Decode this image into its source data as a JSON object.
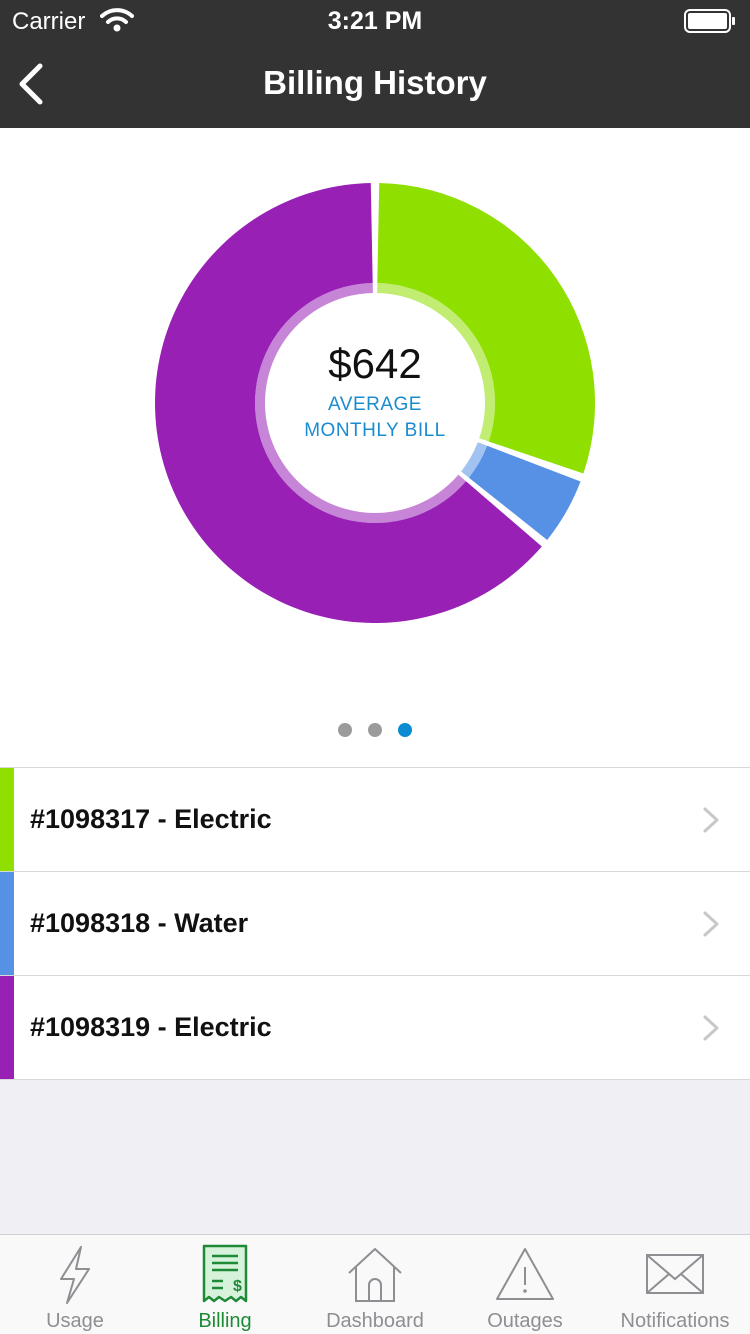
{
  "status_bar": {
    "carrier": "Carrier",
    "time": "3:21 PM"
  },
  "nav": {
    "title": "Billing History"
  },
  "summary": {
    "amount": "$642",
    "label": "AVERAGE MONTHLY BILL"
  },
  "chart_data": {
    "type": "pie",
    "slices": [
      {
        "name": "#1098317 - Electric",
        "fraction": 0.305,
        "color": "#8fdf00"
      },
      {
        "name": "#1098318 - Water",
        "fraction": 0.055,
        "color": "#5691e6"
      },
      {
        "name": "#1098319 - Electric",
        "fraction": 0.64,
        "color": "#9820b5"
      }
    ]
  },
  "pager": {
    "count": 3,
    "active_index": 2,
    "active_color": "#0a8bd2",
    "inactive_color": "#9b9b9b"
  },
  "accounts": [
    {
      "label": "#1098317 - Electric",
      "color": "#8fdf00"
    },
    {
      "label": "#1098318 - Water",
      "color": "#5691e6"
    },
    {
      "label": "#1098319 - Electric",
      "color": "#9820b5"
    }
  ],
  "tabs": [
    {
      "label": "Usage",
      "icon": "lightning-icon",
      "active": false
    },
    {
      "label": "Billing",
      "icon": "bill-icon",
      "active": true
    },
    {
      "label": "Dashboard",
      "icon": "house-icon",
      "active": false
    },
    {
      "label": "Outages",
      "icon": "warning-icon",
      "active": false
    },
    {
      "label": "Notifications",
      "icon": "envelope-icon",
      "active": false
    }
  ],
  "colors": {
    "bar": "#333333",
    "active_tab": "#1e8a36",
    "accent_text": "#1a8ccf"
  }
}
